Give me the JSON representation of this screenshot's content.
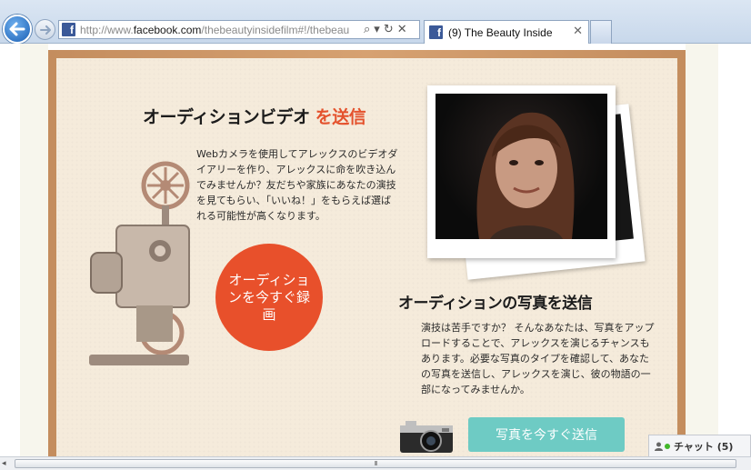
{
  "browser": {
    "url_prefix": "http://www.",
    "url_domain": "facebook.com",
    "url_path": "/thebeautyinsidefilm#!/thebeau",
    "tab_title": "(9) The Beauty Inside",
    "search_icon": "⌕",
    "dropdown_icon": "▾",
    "refresh_icon": "↻",
    "stop_icon": "✕",
    "tab_close_icon": "✕",
    "favicon_letter": "f"
  },
  "video_section": {
    "title_main": "オーディションビデオ",
    "title_accent": "を送信",
    "description": "Webカメラを使用してアレックスのビデオダイアリーを作り、アレックスに命を吹き込んでみませんか？友だちや家族にあなたの演技を見てもらい、「いいね！」をもらえば選ばれる可能性が高くなります。",
    "button_label": "オーディションを今すぐ録画"
  },
  "photo_section": {
    "title": "オーディションの写真を送信",
    "description": "演技は苦手ですか？ そんなあなたは、写真をアップロードすることで、アレックスを演じるチャンスもあります。必要な写真のタイプを確認して、あなたの写真を送信し、アレックスを演じ、彼の物語の一部になってみませんか。",
    "button_label": "写真を今すぐ送信"
  },
  "chat": {
    "label": "チャット (5)"
  },
  "scrollbar": {
    "grip": "III"
  },
  "colors": {
    "accent_orange": "#e4522d",
    "button_orange": "#e8502b",
    "button_teal": "#6ecbc4",
    "frame_wood": "#d6a171",
    "board_paper": "#f5ebdb"
  }
}
